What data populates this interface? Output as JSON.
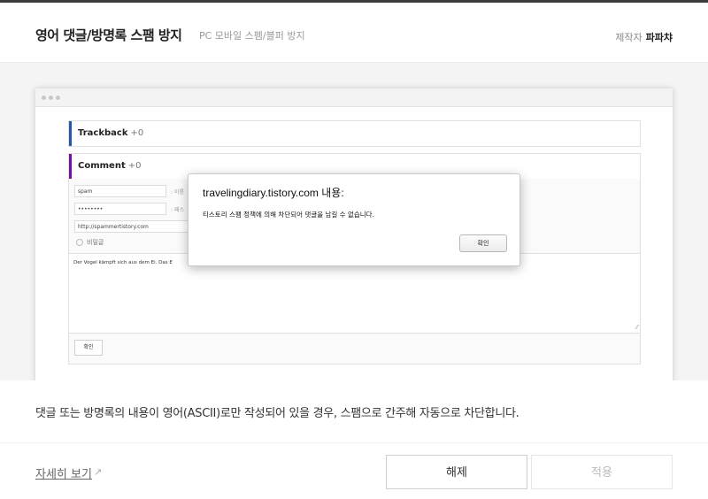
{
  "header": {
    "title": "영어 댓글/방명록 스팸 방지",
    "subtitle": "PC 모바일 스펨/블퍼 방지",
    "maker_label": "제작자",
    "maker_name": "파파챠"
  },
  "preview": {
    "trackback": {
      "label": "Trackback",
      "count": "+0"
    },
    "comment": {
      "label": "Comment",
      "count": "+0"
    },
    "form": {
      "name_value": "spam",
      "name_label": ": 이름",
      "password_value": "••••••••",
      "password_label": ": 패스",
      "url_value": "http://spammertistory.com",
      "secret_label": "비밀글",
      "body_text": "Der Vogel kämpft sich aus dem Ei. Das E",
      "submit_label": "확인"
    },
    "alert": {
      "title": "travelingdiary.tistory.com 내용:",
      "message": "티스토리 스팸 정책에 의해 차단되어 댓글을 남길 수 없습니다.",
      "ok_label": "확인"
    }
  },
  "description": "댓글 또는 방명록의 내용이 영어(ASCII)로만 작성되어 있을 경우, 스팸으로 간주해 자동으로 차단합니다.",
  "footer": {
    "more_label": "자세히 보기",
    "release_label": "해제",
    "apply_label": "적용"
  },
  "colors": {
    "trackback_accent": "#2b5797",
    "comment_accent": "#6a1b8a"
  }
}
